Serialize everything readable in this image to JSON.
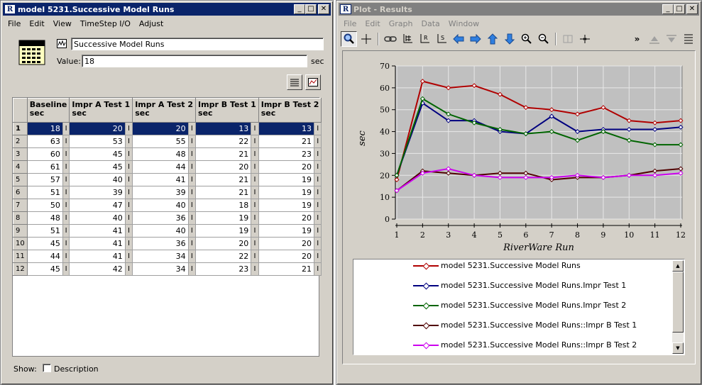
{
  "left_window": {
    "title": "model 5231.Successive Model Runs",
    "title_icon": "R",
    "menu": [
      "File",
      "Edit",
      "View",
      "TimeStep I/O",
      "Adjust"
    ],
    "name_value": "Successive Model Runs",
    "value_label": "Value:",
    "value": "18",
    "unit": "sec",
    "show_label": "Show:",
    "description_label": "Description",
    "columns": [
      {
        "name": "Baseline",
        "unit": "sec"
      },
      {
        "name": "Impr A Test 1",
        "unit": "sec"
      },
      {
        "name": "Impr A Test 2",
        "unit": "sec"
      },
      {
        "name": "Impr B Test 1",
        "unit": "sec"
      },
      {
        "name": "Impr B Test 2",
        "unit": "sec"
      }
    ],
    "flag": "I",
    "rows": [
      {
        "id": "1",
        "values": [
          "18",
          "20",
          "20",
          "13",
          "13"
        ]
      },
      {
        "id": "2",
        "values": [
          "63",
          "53",
          "55",
          "22",
          "21"
        ]
      },
      {
        "id": "3",
        "values": [
          "60",
          "45",
          "48",
          "21",
          "23"
        ]
      },
      {
        "id": "4",
        "values": [
          "61",
          "45",
          "44",
          "20",
          "20"
        ]
      },
      {
        "id": "5",
        "values": [
          "57",
          "40",
          "41",
          "21",
          "19"
        ]
      },
      {
        "id": "6",
        "values": [
          "51",
          "39",
          "39",
          "21",
          "19"
        ]
      },
      {
        "id": "7",
        "values": [
          "50",
          "47",
          "40",
          "18",
          "19"
        ]
      },
      {
        "id": "8",
        "values": [
          "48",
          "40",
          "36",
          "19",
          "20"
        ]
      },
      {
        "id": "9",
        "values": [
          "51",
          "41",
          "40",
          "19",
          "19"
        ]
      },
      {
        "id": "10",
        "values": [
          "45",
          "41",
          "36",
          "20",
          "20"
        ]
      },
      {
        "id": "11",
        "values": [
          "44",
          "41",
          "34",
          "22",
          "20"
        ]
      },
      {
        "id": "12",
        "values": [
          "45",
          "42",
          "34",
          "23",
          "21"
        ]
      }
    ],
    "selected_row": 0
  },
  "right_window": {
    "title": "Plot - Results",
    "title_icon": "R",
    "menu": [
      "File",
      "Edit",
      "Graph",
      "Data",
      "Window"
    ],
    "toolbar_icons": [
      "zoom-lens-icon",
      "crosshair-icon",
      "link-icon",
      "axis-icon",
      "axis-reset-icon",
      "axis-scale-icon",
      "arrow-left-icon",
      "arrow-right-icon",
      "arrow-up-icon",
      "arrow-down-icon",
      "zoom-in-icon",
      "zoom-out-icon",
      "split-icon",
      "compress-icon",
      "more-icon",
      "move-up-icon",
      "move-down-icon",
      "list-icon"
    ]
  },
  "chart_data": {
    "type": "line",
    "xlabel": "RiverWare Run",
    "ylabel": "sec",
    "x": [
      1,
      2,
      3,
      4,
      5,
      6,
      7,
      8,
      9,
      10,
      11,
      12
    ],
    "xlim": [
      1,
      12
    ],
    "ylim": [
      0,
      70
    ],
    "yticks": [
      0,
      10,
      20,
      30,
      40,
      50,
      60,
      70
    ],
    "grid": true,
    "background": "#c0c0c0",
    "series": [
      {
        "name": "model 5231.Successive Model Runs",
        "color": "#b00000",
        "values": [
          18,
          63,
          60,
          61,
          57,
          51,
          50,
          48,
          51,
          45,
          44,
          45
        ]
      },
      {
        "name": "model 5231.Successive Model Runs.Impr Test 1",
        "color": "#00007f",
        "values": [
          20,
          53,
          45,
          45,
          40,
          39,
          47,
          40,
          41,
          41,
          41,
          42
        ]
      },
      {
        "name": "model 5231.Successive Model Runs.Impr Test 2",
        "color": "#006400",
        "values": [
          20,
          55,
          48,
          44,
          41,
          39,
          40,
          36,
          40,
          36,
          34,
          34
        ]
      },
      {
        "name": "model 5231.Successive Model Runs::Impr B Test 1",
        "color": "#500000",
        "values": [
          13,
          22,
          21,
          20,
          21,
          21,
          18,
          19,
          19,
          20,
          22,
          23
        ]
      },
      {
        "name": "model 5231.Successive Model Runs::Impr B Test 2",
        "color": "#cc00ee",
        "values": [
          13,
          21,
          23,
          20,
          19,
          19,
          19,
          20,
          19,
          20,
          20,
          21
        ]
      }
    ]
  }
}
